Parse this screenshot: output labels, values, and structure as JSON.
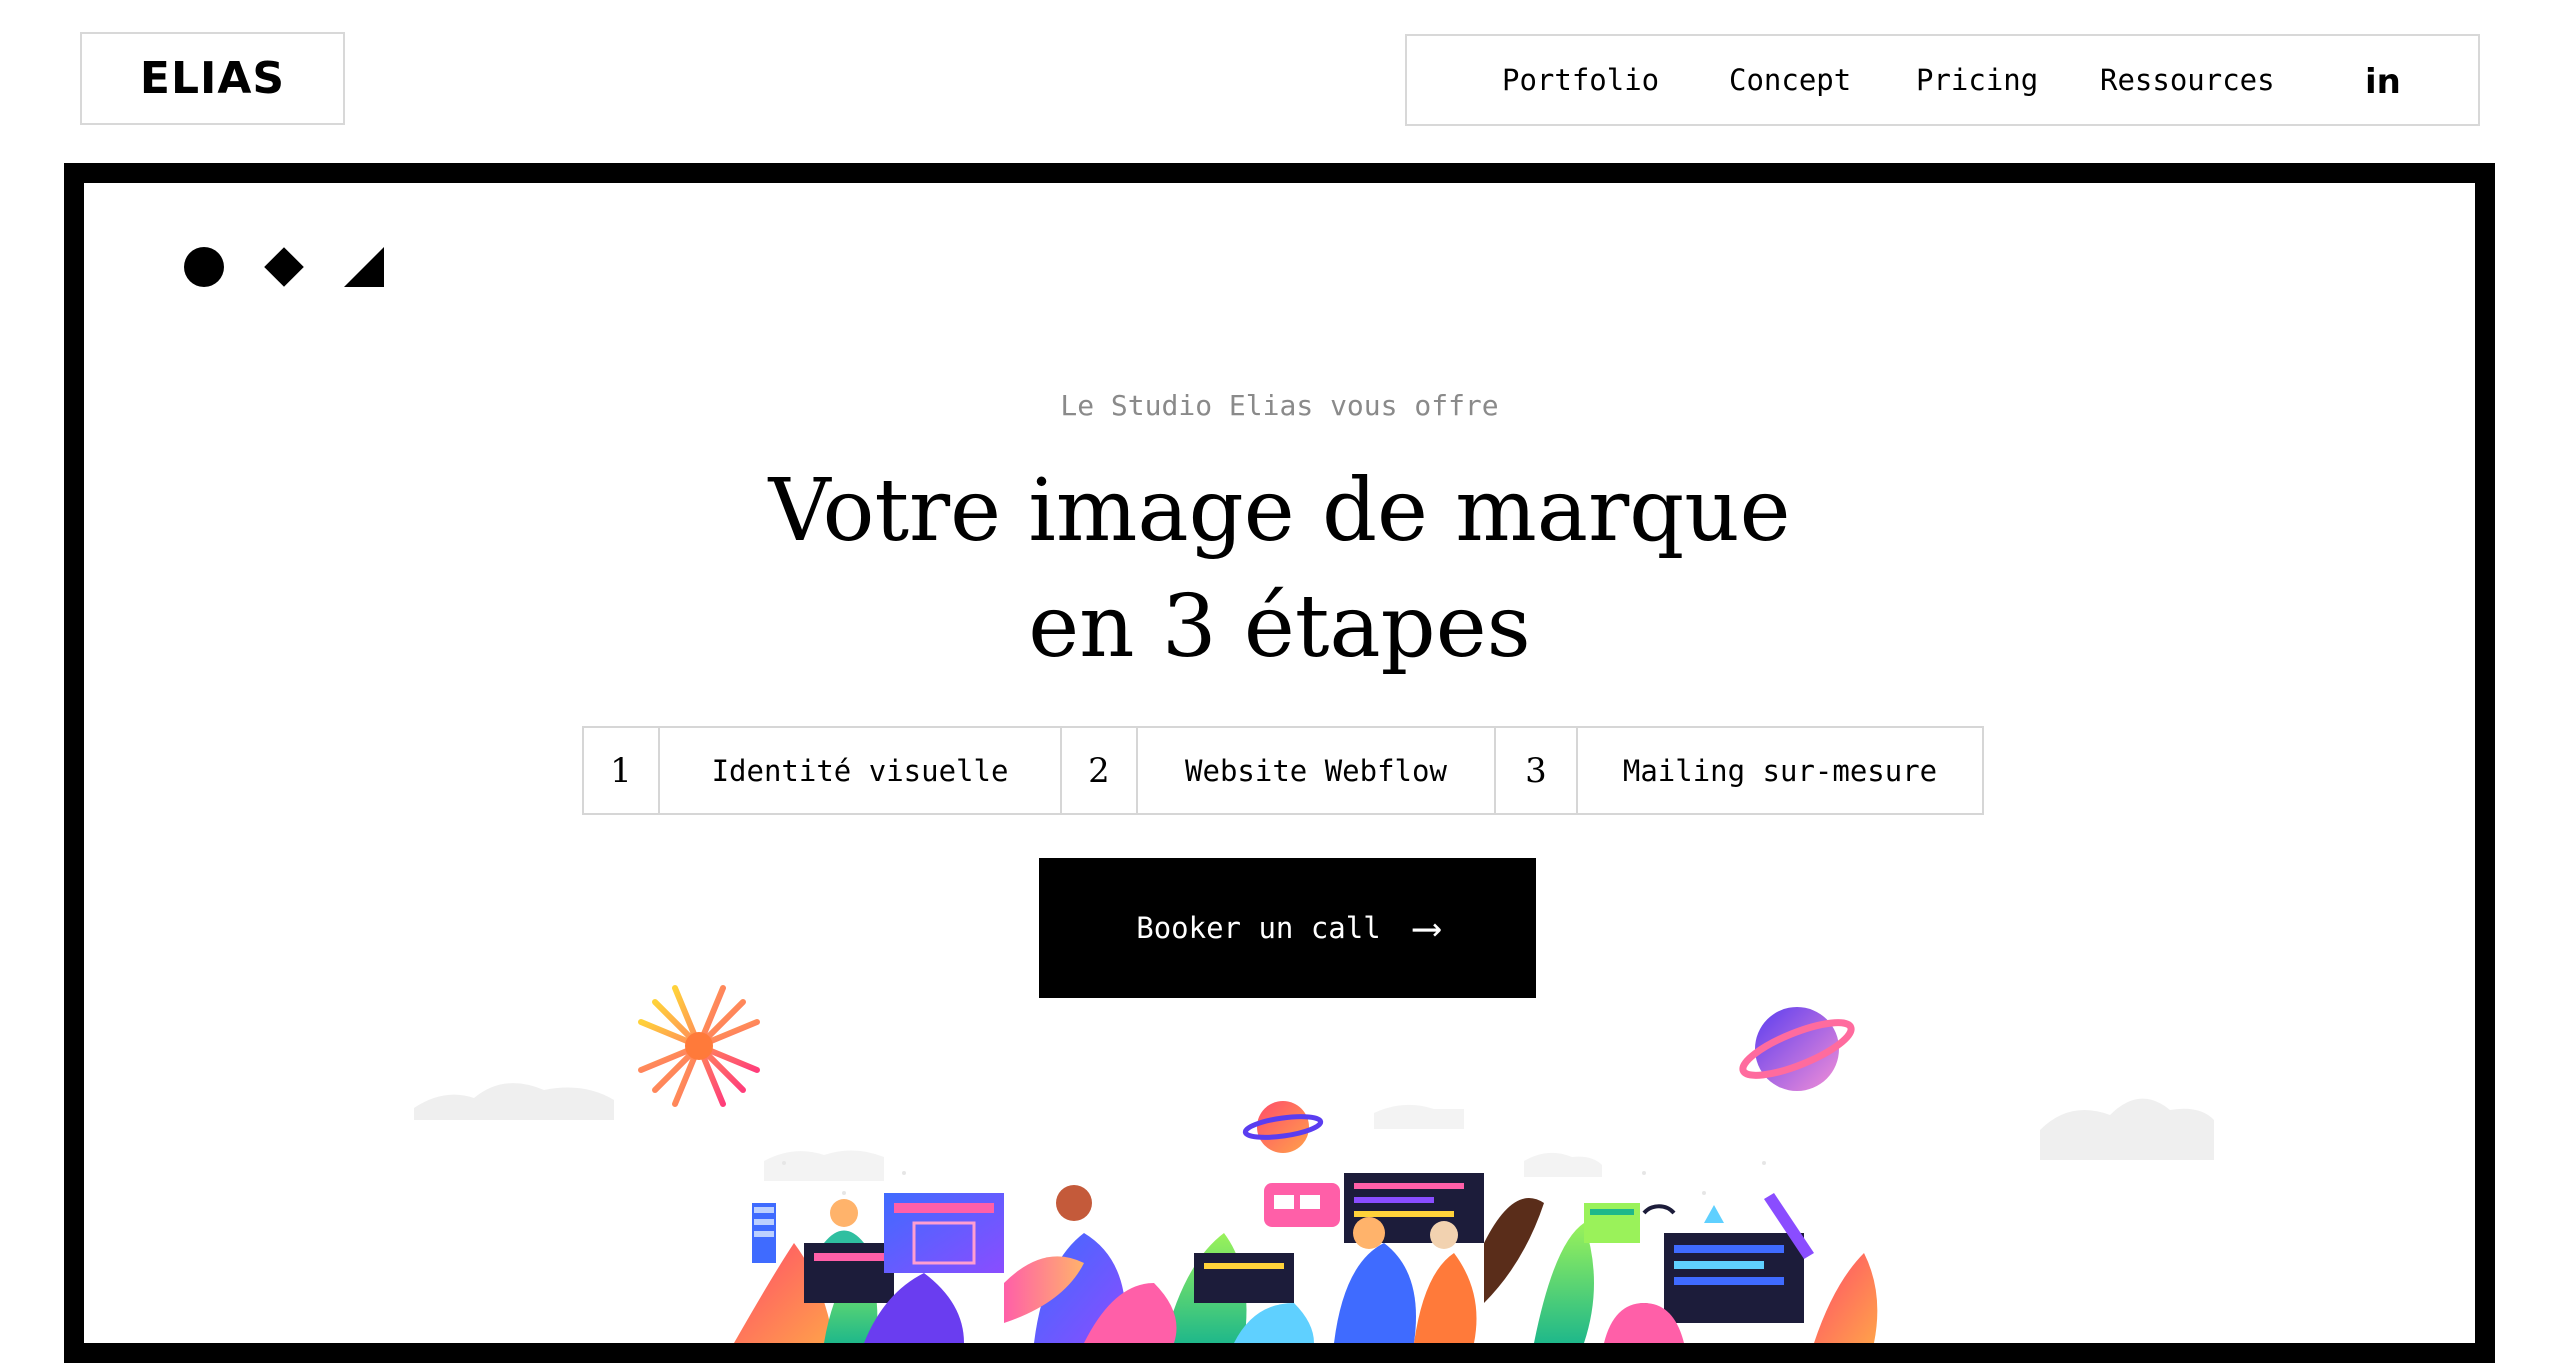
{
  "header": {
    "logo": "ELIAS",
    "nav": [
      {
        "label": "Portfolio"
      },
      {
        "label": "Concept"
      },
      {
        "label": "Pricing"
      },
      {
        "label": "Ressources"
      }
    ],
    "social_icon": "linkedin-icon",
    "social_label": "in"
  },
  "hero": {
    "decor_icons": [
      "circle-icon",
      "diamond-icon",
      "triangle-icon"
    ],
    "eyebrow": "Le Studio Elias vous offre",
    "headline_line1": "Votre image de marque",
    "headline_line2": "en 3 étapes",
    "steps": [
      {
        "number": "1",
        "label": "Identité visuelle"
      },
      {
        "number": "2",
        "label": "Website Webflow"
      },
      {
        "number": "3",
        "label": "Mailing sur-mesure"
      }
    ],
    "cta_label": "Booker un call",
    "cta_arrow": "⟶"
  },
  "colors": {
    "text": "#000000",
    "muted": "#8a8a8a",
    "border": "#d8d8d8",
    "frame": "#000000",
    "cta_bg": "#000000",
    "cta_text": "#ffffff"
  }
}
